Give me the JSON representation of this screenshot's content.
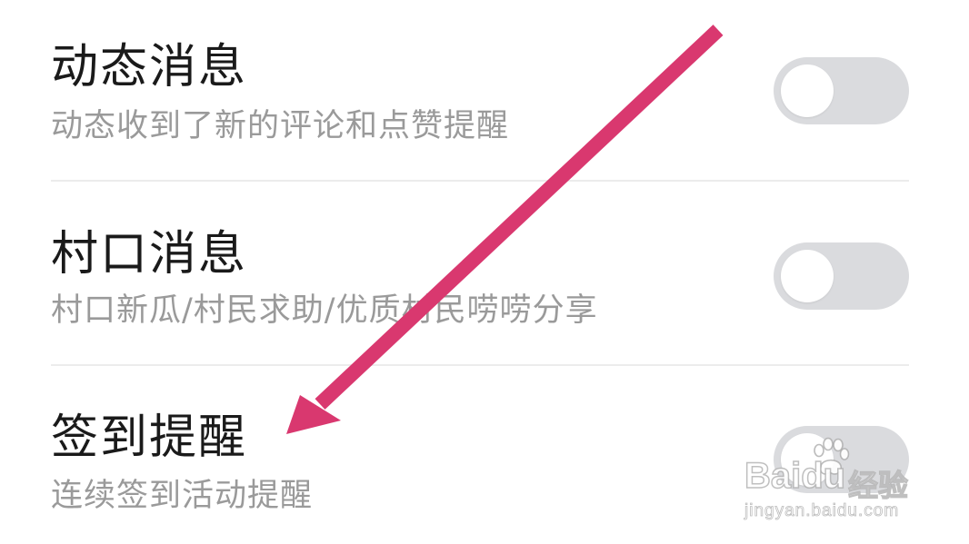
{
  "settings": {
    "items": [
      {
        "title": "动态消息",
        "subtitle": "动态收到了新的评论和点赞提醒",
        "enabled": false
      },
      {
        "title": "村口消息",
        "subtitle": "村口新瓜/村民求助/优质村民唠唠分享",
        "enabled": false
      },
      {
        "title": "签到提醒",
        "subtitle": "连续签到活动提醒",
        "enabled": false
      }
    ]
  },
  "annotation": {
    "arrow_color": "#d9386f"
  },
  "watermark": {
    "brand": "Baidu",
    "brand_cn": "经验",
    "url": "jingyan.baidu.com"
  },
  "colors": {
    "toggle_off": "#dadbde",
    "title": "#1a1a1a",
    "subtitle": "#9a9a9a"
  }
}
